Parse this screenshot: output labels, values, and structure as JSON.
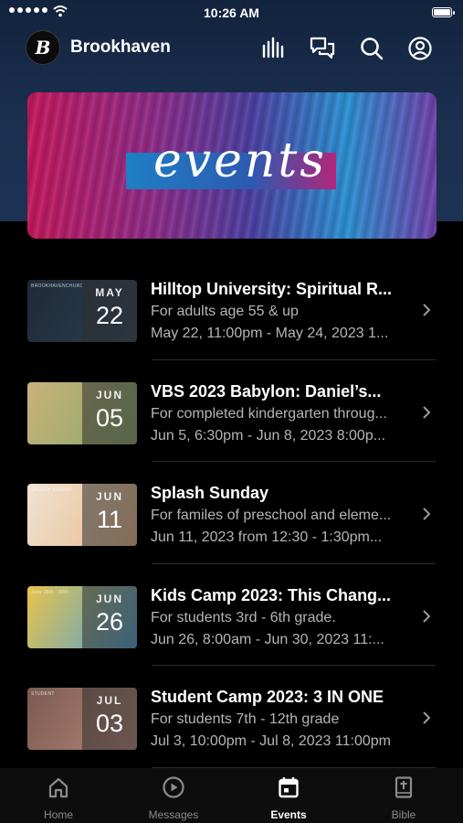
{
  "status_bar": {
    "time": "10:26 AM"
  },
  "header": {
    "logo_letter": "B",
    "app_name": "Brookhaven",
    "icons": [
      "audio-bars-icon",
      "chat-icon",
      "search-icon",
      "account-icon"
    ]
  },
  "banner": {
    "text": "events"
  },
  "events": [
    {
      "title": "Hilltop University: Spiritual R...",
      "subtitle": "For adults age 55 & up",
      "dates": "May 22, 11:00pm - May 24, 2023 1...",
      "month": "MAY",
      "day": "22",
      "thumb_text": "BROOKHAVENCHURCH.COM/EVENTS/HILLTOP",
      "thumb_colors": [
        "#1e2a36",
        "#2b3f55"
      ]
    },
    {
      "title": "VBS 2023 Babylon: Daniel’s...",
      "subtitle": "For completed kindergarten throug...",
      "dates": "Jun 5, 6:30pm - Jun 8, 2023 8:00p...",
      "month": "JUN",
      "day": "05",
      "thumb_text": "",
      "thumb_colors": [
        "#c9b27a",
        "#8aa86a"
      ]
    },
    {
      "title": "Splash Sunday",
      "subtitle": "For familes of preschool and eleme...",
      "dates": "Jun 11, 2023 from 12:30 - 1:30pm...",
      "month": "JUN",
      "day": "11",
      "thumb_text": "SPLASH SUNDAY",
      "thumb_colors": [
        "#efe3d2",
        "#e9b98a"
      ]
    },
    {
      "title": "Kids Camp 2023: This Chang...",
      "subtitle": "For students 3rd - 6th grade.",
      "dates": "Jun 26, 8:00am - Jun 30, 2023 11:...",
      "month": "JUN",
      "day": "26",
      "thumb_text": "June 26th - 30th",
      "thumb_colors": [
        "#e8c34a",
        "#4aa0d8"
      ]
    },
    {
      "title": "Student Camp 2023: 3 IN ONE",
      "subtitle": "For students 7th - 12th grade",
      "dates": "Jul 3, 10:00pm - Jul 8, 2023 11:00pm",
      "month": "JUL",
      "day": "03",
      "thumb_text": "STUDENT",
      "thumb_colors": [
        "#7a5a52",
        "#b88878"
      ]
    }
  ],
  "tabs": [
    {
      "label": "Home",
      "icon": "home-icon",
      "active": false
    },
    {
      "label": "Messages",
      "icon": "play-circle-icon",
      "active": false
    },
    {
      "label": "Events",
      "icon": "calendar-icon",
      "active": true
    },
    {
      "label": "Bible",
      "icon": "bible-icon",
      "active": false
    }
  ]
}
